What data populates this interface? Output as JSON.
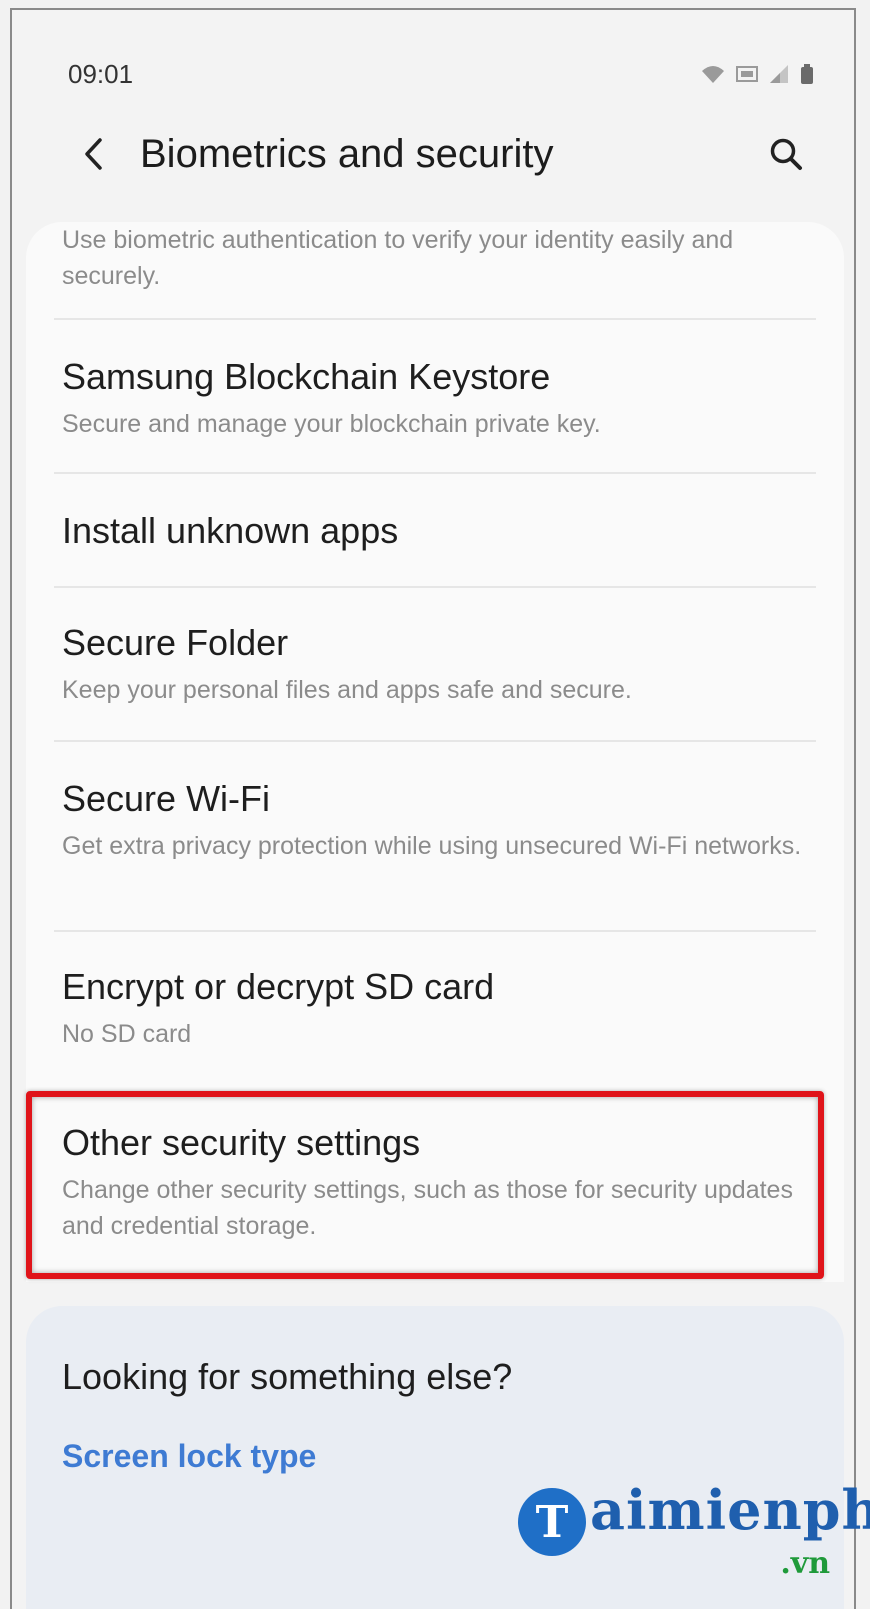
{
  "status_bar": {
    "time": "09:01"
  },
  "header": {
    "title": "Biometrics and security"
  },
  "list": {
    "partial_item_subtitle": "Use biometric authentication to verify your identity easily and securely.",
    "items": [
      {
        "title": "Samsung Blockchain Keystore",
        "subtitle": "Secure and manage your blockchain private key."
      },
      {
        "title": "Install unknown apps",
        "subtitle": ""
      },
      {
        "title": "Secure Folder",
        "subtitle": "Keep your personal files and apps safe and secure."
      },
      {
        "title": "Secure Wi-Fi",
        "subtitle": "Get extra privacy protection while using unsecured Wi-Fi networks."
      },
      {
        "title": "Encrypt or decrypt SD card",
        "subtitle": "No SD card"
      },
      {
        "title": "Other security settings",
        "subtitle": "Change other security settings, such as those for security updates and credential storage."
      }
    ]
  },
  "suggestions": {
    "title": "Looking for something else?",
    "link": "Screen lock type"
  },
  "watermark": {
    "initial": "T",
    "text": "aimienphi",
    "suffix": ".vn"
  },
  "colors": {
    "highlight": "#e0141a",
    "link": "#3e7bd3"
  }
}
